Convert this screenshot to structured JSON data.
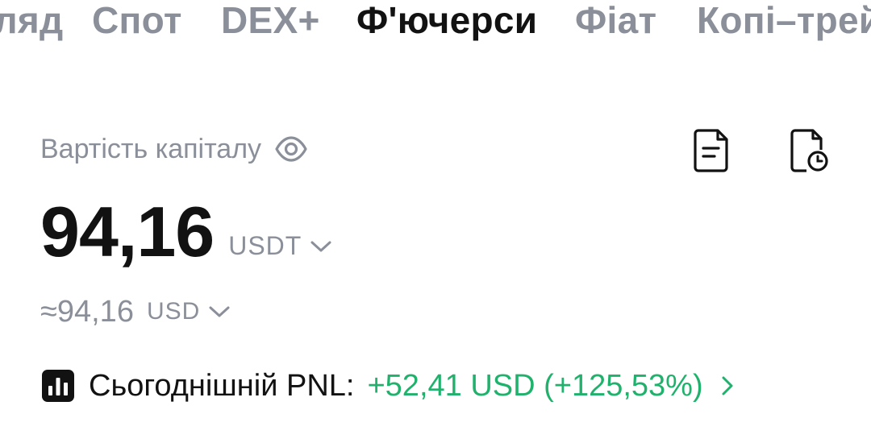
{
  "tabs": [
    {
      "label": "Огляд"
    },
    {
      "label": "Спот"
    },
    {
      "label": "DEX+"
    },
    {
      "label": "Ф'ючерси",
      "active": true
    },
    {
      "label": "Фіат"
    },
    {
      "label": "Копі–трейдинг"
    }
  ],
  "equity": {
    "label": "Вартість капіталу",
    "amount": "94,16",
    "unit": "USDT",
    "approx_value": "≈94,16",
    "approx_unit": "USD"
  },
  "pnl": {
    "label": "Сьогоднішній PNL:",
    "value": "+52,41 USD (+125,53%)",
    "color": "#20b26c"
  },
  "icons": [
    "eye-icon",
    "document-icon",
    "document-clock-icon",
    "chevron-down-icon",
    "bar-chart-icon",
    "chevron-right-icon"
  ]
}
